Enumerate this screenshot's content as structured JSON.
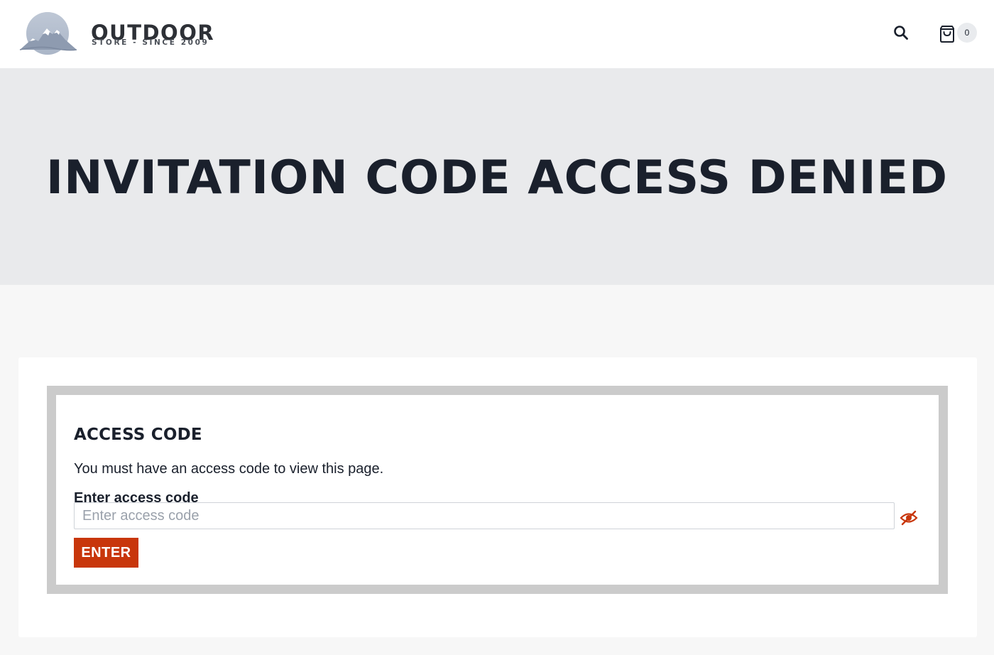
{
  "header": {
    "logo_title": "OUTDOOR",
    "logo_subtitle": "STORE - SINCE 2009",
    "search_icon": "search-icon",
    "cart_icon": "shopping-bag-icon",
    "cart_count": "0"
  },
  "hero": {
    "title": "INVITATION CODE ACCESS DENIED"
  },
  "access": {
    "title": "ACCESS CODE",
    "description": "You must have an access code to view this page.",
    "field_label": "Enter access code",
    "input_placeholder": "Enter access code",
    "input_value": "",
    "toggle_icon": "eye-slash-icon",
    "submit_label": "ENTER"
  },
  "colors": {
    "accent": "#c8360b",
    "text": "#1a202c",
    "hero_bg": "#e9eaec",
    "box_border": "#cbcbcb"
  }
}
